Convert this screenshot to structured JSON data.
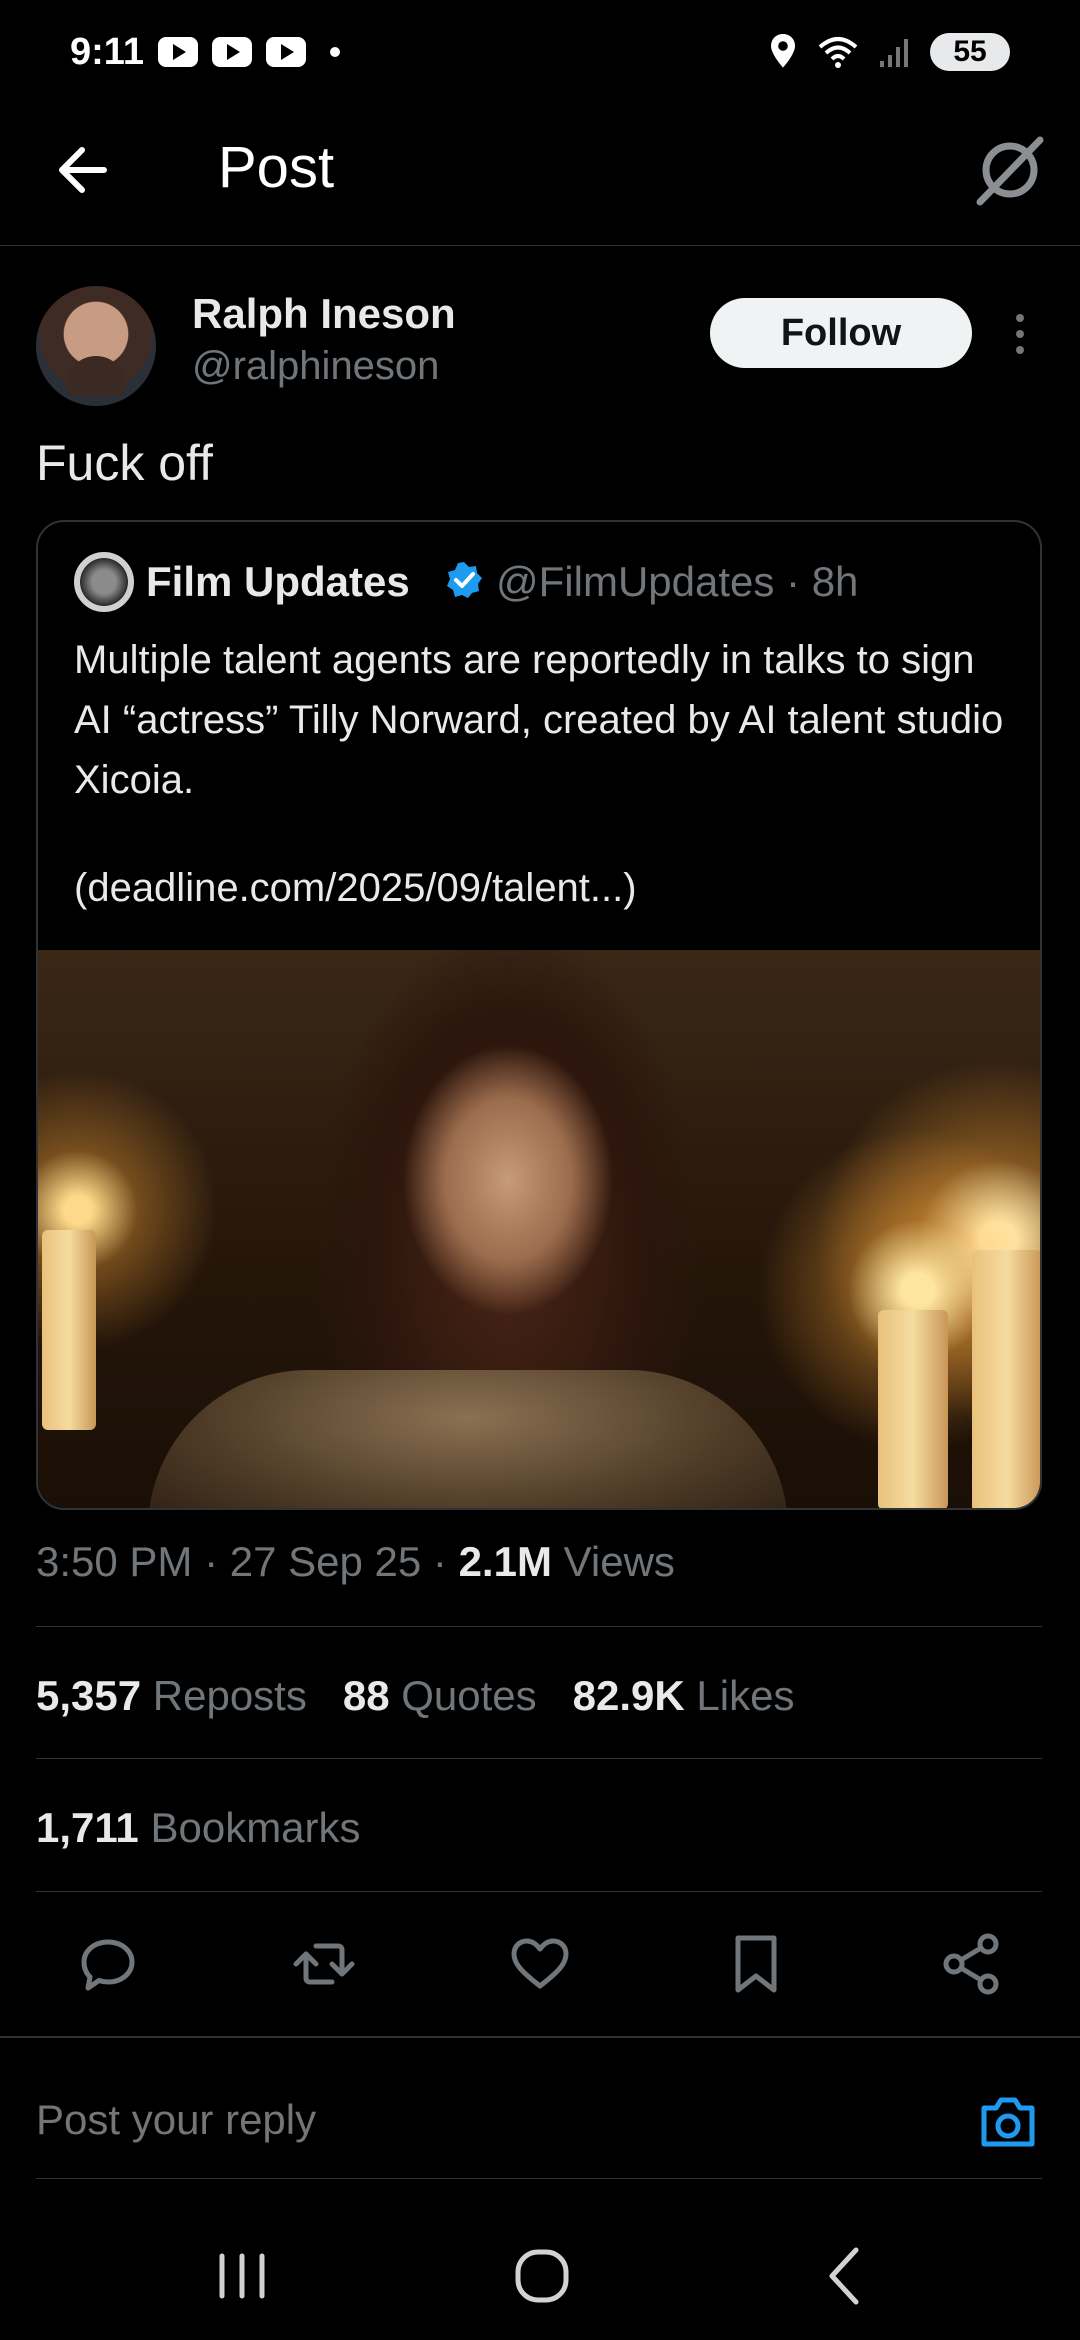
{
  "status_bar": {
    "time": "9:11",
    "battery": "55"
  },
  "header": {
    "title": "Post"
  },
  "post": {
    "author_name": "Ralph Ineson",
    "author_handle": "@ralphineson",
    "follow_label": "Follow",
    "text": "Fuck off",
    "timestamp": "3:50 PM · 27 Sep 25 · ",
    "views_count": "2.1M",
    "views_label": " Views",
    "reposts_count": "5,357",
    "reposts_label": " Reposts",
    "quotes_count": "88",
    "quotes_label": " Quotes",
    "likes_count": "82.9K",
    "likes_label": " Likes",
    "bookmarks_count": "1,711",
    "bookmarks_label": " Bookmarks"
  },
  "quote": {
    "author_name": "Film Updates",
    "meta": "@FilmUpdates · 8h",
    "text": "Multiple talent agents are reportedly in talks to sign AI “actress” Tilly Norward, created by AI talent studio Xicoia.",
    "link": "(deadline.com/2025/09/talent...)"
  },
  "reply": {
    "placeholder": "Post your reply"
  },
  "colors": {
    "background": "#000000",
    "text": "#e7e9ea",
    "muted": "#71767b",
    "accent": "#1d9bf0",
    "divider": "#2f3336"
  },
  "icons": {
    "back": "arrow-left-icon",
    "grok": "grok-icon",
    "more": "more-vertical-icon",
    "verified": "verified-badge-icon",
    "reply": "reply-icon",
    "repost": "repost-icon",
    "like": "heart-icon",
    "bookmark": "bookmark-icon",
    "share": "share-icon",
    "camera": "camera-icon"
  }
}
